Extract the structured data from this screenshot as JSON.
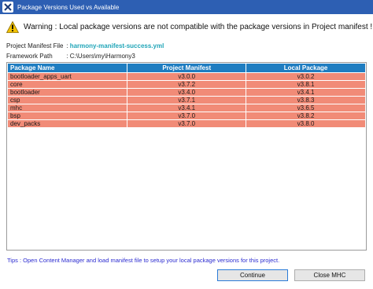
{
  "window": {
    "title": "Package Versions Used vs Available",
    "app_icon": "x-logo-icon"
  },
  "warning": {
    "icon": "warning-triangle-icon",
    "text": "Warning : Local package versions are not compatible with the package versions in Project manifest !"
  },
  "info": {
    "manifest_label": "Project Manifest File",
    "manifest_sep": ":",
    "manifest_value": "harmony-manifest-success.yml",
    "framework_label": "Framework Path",
    "framework_sep": ":",
    "framework_value": "C:\\Users\\my\\Harmony3"
  },
  "table": {
    "headers": [
      "Package Name",
      "Project Manifest",
      "Local Package"
    ],
    "rows": [
      [
        "bootloader_apps_uart",
        "v3.0.0",
        "v3.0.2"
      ],
      [
        "core",
        "v3.7.2",
        "v3.8.1"
      ],
      [
        "bootloader",
        "v3.4.0",
        "v3.4.1"
      ],
      [
        "csp",
        "v3.7.1",
        "v3.8.3"
      ],
      [
        "mhc",
        "v3.4.1",
        "v3.6.5"
      ],
      [
        "bsp",
        "v3.7.0",
        "v3.8.2"
      ],
      [
        "dev_packs",
        "v3.7.0",
        "v3.8.0"
      ]
    ],
    "header_color": "#1f7dc1",
    "row_color": "#f18b77"
  },
  "tips": "Tips : Open Content Manager and load manifest file to setup your local package versions for this project.",
  "buttons": {
    "continue": "Continue",
    "close": "Close MHC"
  }
}
